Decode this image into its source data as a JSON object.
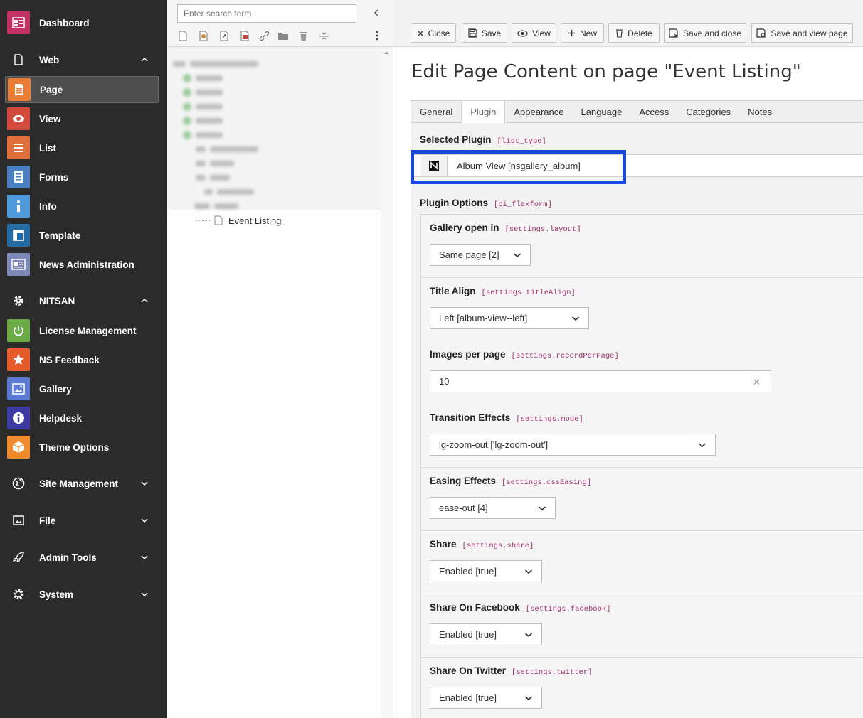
{
  "sidebar": {
    "dashboard": "Dashboard",
    "web_group": "Web",
    "web_items": [
      {
        "label": "Page",
        "icon": "page-icon",
        "color": "#ea7d35"
      },
      {
        "label": "View",
        "icon": "eye-icon",
        "color": "#d44a3d"
      },
      {
        "label": "List",
        "icon": "list-icon",
        "color": "#e06f3b"
      },
      {
        "label": "Forms",
        "icon": "forms-icon",
        "color": "#4a7fc1"
      },
      {
        "label": "Info",
        "icon": "info-icon",
        "color": "#4f9ad9"
      },
      {
        "label": "Template",
        "icon": "template-icon",
        "color": "#246ca5"
      },
      {
        "label": "News Administration",
        "icon": "news-icon",
        "color": "#7d87b8"
      }
    ],
    "nitsan_group": "NITSAN",
    "nitsan_items": [
      {
        "label": "License Management",
        "icon": "power-icon",
        "color": "#6bab45"
      },
      {
        "label": "NS Feedback",
        "icon": "star-icon",
        "color": "#e55c2a"
      },
      {
        "label": "Gallery",
        "icon": "image-icon",
        "color": "#5d79d1"
      },
      {
        "label": "Helpdesk",
        "icon": "help-icon",
        "color": "#3e3aa4"
      },
      {
        "label": "Theme Options",
        "icon": "box-icon",
        "color": "#ef8a2d"
      }
    ],
    "groups": [
      "Site Management",
      "File",
      "Admin Tools",
      "System"
    ]
  },
  "tree": {
    "search_placeholder": "Enter search term",
    "selected_page": "Event Listing"
  },
  "toolbar": {
    "close": "Close",
    "save": "Save",
    "view": "View",
    "new": "New",
    "delete": "Delete",
    "save_close": "Save and close",
    "save_view": "Save and view page"
  },
  "main": {
    "title": "Edit Page Content on page \"Event Listing\"",
    "tabs": [
      "General",
      "Plugin",
      "Appearance",
      "Language",
      "Access",
      "Categories",
      "Notes"
    ],
    "active_tab": "Plugin",
    "selected_plugin_label": "Selected Plugin",
    "selected_plugin_code": "[list_type]",
    "selected_plugin_value": "Album View [nsgallery_album]",
    "plugin_options_label": "Plugin Options",
    "plugin_options_code": "[pi_flexform]",
    "highlight_color": "#1a49d8"
  },
  "fields": [
    {
      "label": "Gallery open in",
      "code": "[settings.layout]",
      "value": "Same page [2]"
    },
    {
      "label": "Title Align",
      "code": "[settings.titleAlign]",
      "value": "Left [album-view--left]"
    },
    {
      "label": "Images per page",
      "code": "[settings.recordPerPage]",
      "value": "10"
    },
    {
      "label": "Transition Effects",
      "code": "[settings.mode]",
      "value": "lg-zoom-out ['lg-zoom-out']"
    },
    {
      "label": "Easing Effects",
      "code": "[settings.cssEasing]",
      "value": "ease-out [4]"
    },
    {
      "label": "Share",
      "code": "[settings.share]",
      "value": "Enabled [true]"
    },
    {
      "label": "Share On Facebook",
      "code": "[settings.facebook]",
      "value": "Enabled [true]"
    },
    {
      "label": "Share On Twitter",
      "code": "[settings.twitter]",
      "value": "Enabled [true]"
    }
  ]
}
